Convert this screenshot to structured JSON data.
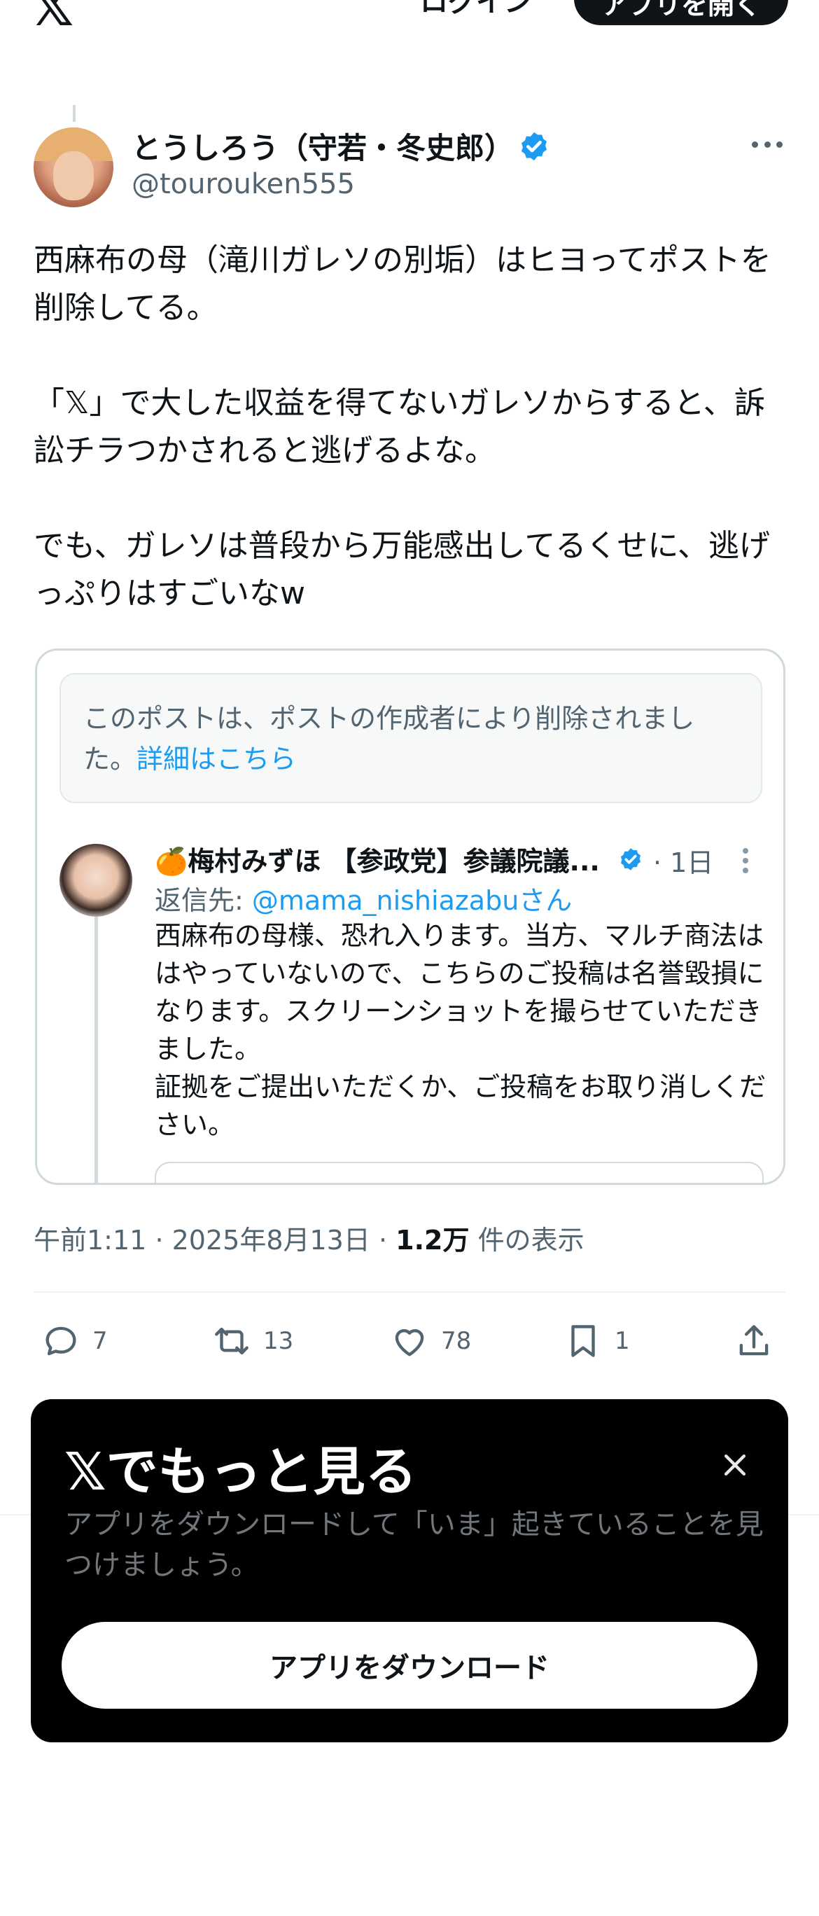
{
  "topbar": {
    "logo": "𝕏",
    "login_label": "ログイン",
    "open_app_label": "アプリを開く"
  },
  "post": {
    "author_name": "とうしろう（守若・冬史郎）",
    "author_handle": "@tourouken555",
    "text": "西麻布の母（滝川ガレソの別垢）はヒヨってポストを削除してる。\n\n「𝕏」で大した収益を得てないガレソからすると、訴訟チラつかされると逃げるよな。\n\nでも、ガレソは普段から万能感出してるくせに、逃げっぷりはすごいなw",
    "time": "午前1:11",
    "date": "2025年8月13日",
    "views_count": "1.2万",
    "views_label": "件の表示",
    "sep": "·"
  },
  "embed": {
    "deleted_notice": "このポストは、ポストの作成者により削除されました。",
    "deleted_link": "詳細はこちら",
    "inner_name": "🍊梅村みずほ 【参政党】参議院議...",
    "inner_time": "· 1日",
    "reply_prefix": "返信先: ",
    "reply_mention": "@mama_nishiazabuさん",
    "inner_text": "西麻布の母様、恐れ入ります。当方、マルチ商法ははやっていないので、こちらのご投稿は名誉毀損になります。スクリーンショットを撮らせていただきました。\n証拠をご提出いただくか、ご投稿をお取り消しください。"
  },
  "actions": {
    "replies": "7",
    "reposts": "13",
    "likes": "78",
    "bookmarks": "1"
  },
  "promo": {
    "title": "𝕏でもっと見る",
    "subtitle": "アプリをダウンロードして「いま」起きていることを見つけましょう。",
    "button_label": "アプリをダウンロード"
  },
  "colors": {
    "accent": "#1d9bf0",
    "text": "#0f1419",
    "muted": "#536471",
    "border": "#cfd9de"
  }
}
